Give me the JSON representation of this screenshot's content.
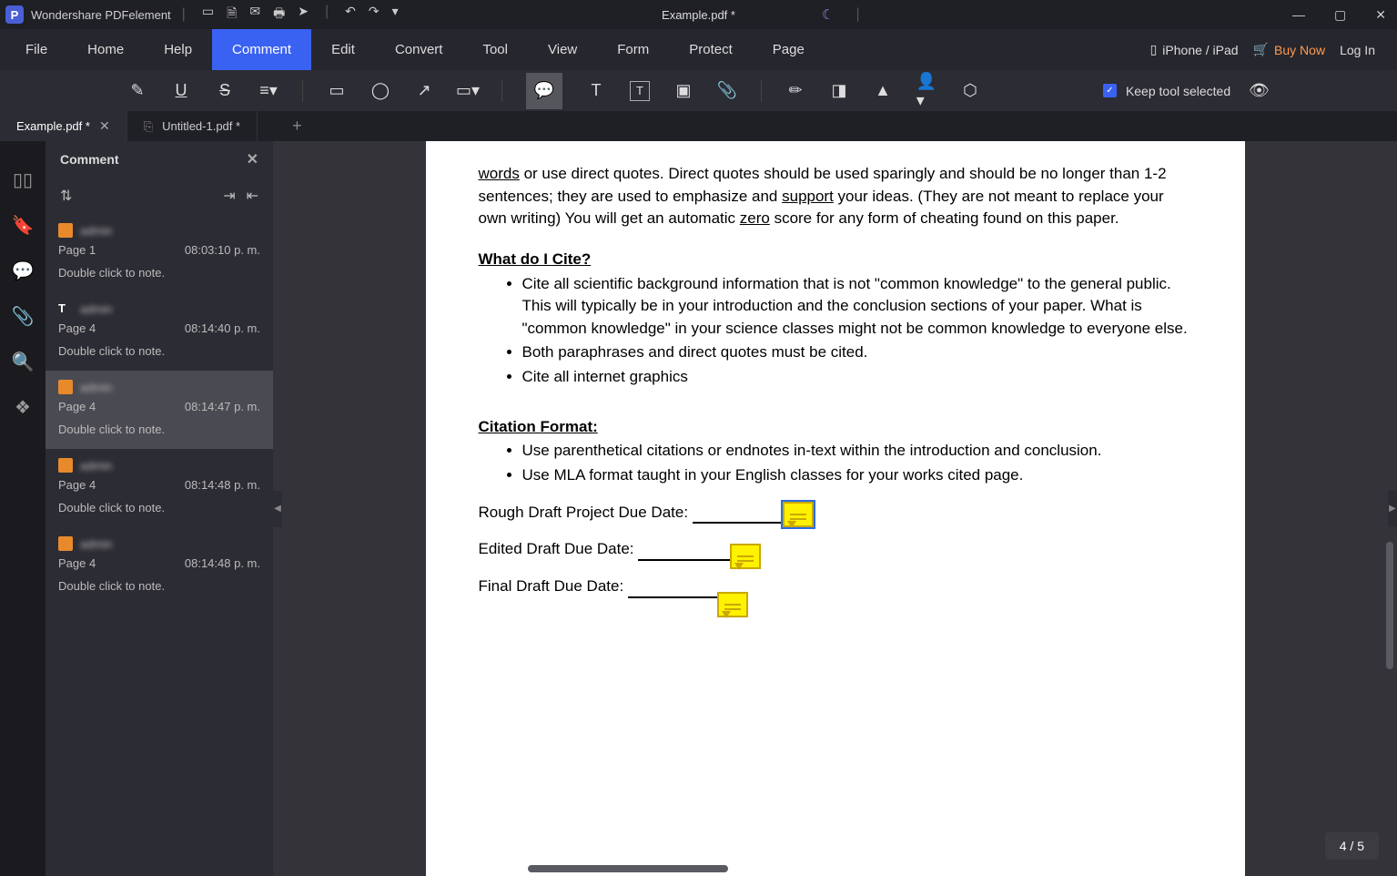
{
  "app": {
    "name": "Wondershare PDFelement",
    "doc_title": "Example.pdf *"
  },
  "titlebar_quick": [
    "folder",
    "save",
    "mail",
    "print",
    "share",
    "",
    "undo",
    "redo",
    "more"
  ],
  "window_controls": {
    "min": "—",
    "max": "▢",
    "close": "✕"
  },
  "menus": [
    "File",
    "Home",
    "Help",
    "Comment",
    "Edit",
    "Convert",
    "Tool",
    "View",
    "Form",
    "Protect",
    "Page"
  ],
  "menu_active_index": 3,
  "header_right": {
    "phone": "iPhone / iPad",
    "buy": "Buy Now",
    "login": "Log In"
  },
  "toolbar": {
    "keep_label": "Keep tool selected"
  },
  "tabs": [
    {
      "label": "Example.pdf *",
      "active": true
    },
    {
      "label": "Untitled-1.pdf *",
      "active": false
    }
  ],
  "panel": {
    "title": "Comment"
  },
  "comments": [
    {
      "page": "Page 1",
      "time": "08:03:10 p. m.",
      "text": "Double click to note.",
      "icon": "note",
      "author": "admin"
    },
    {
      "page": "Page 4",
      "time": "08:14:40 p. m.",
      "text": "Double click to note.",
      "icon": "T",
      "author": "admin"
    },
    {
      "page": "Page 4",
      "time": "08:14:47 p. m.",
      "text": "Double click to note.",
      "icon": "note",
      "author": "admin",
      "selected": true
    },
    {
      "page": "Page 4",
      "time": "08:14:48 p. m.",
      "text": "Double click to note.",
      "icon": "note",
      "author": "admin"
    },
    {
      "page": "Page 4",
      "time": "08:14:48 p. m.",
      "text": "Double click to note.",
      "icon": "note",
      "author": "admin"
    }
  ],
  "page_indicator": "4 / 5",
  "document": {
    "para1_pre": "",
    "para1": " or use direct quotes.   Direct quotes should be used sparingly and should be no longer than 1-2 sentences; they are used to emphasize and ",
    "para1_words": "words",
    "para1_support": "support",
    "para1_b": " your ideas.  (They are not meant to replace your own writing) You will get an automatic ",
    "para1_zero": "zero",
    "para1_c": " score for any form of cheating found on this paper.",
    "h1": "What do I Cite?",
    "b1": "Cite all scientific background information that is not \"common knowledge\" to the general public.  This will typically be in your introduction and the conclusion sections of your paper. What is \"common knowledge\" in your science classes might not be common knowledge to everyone else.",
    "b2": "Both paraphrases and direct quotes must be cited.",
    "b3": "Cite all internet graphics",
    "h2": "Citation Format:",
    "c1": "Use parenthetical citations or endnotes in-text within the introduction and conclusion.",
    "c2": "Use MLA format taught in your English classes for your works cited page.",
    "d1": "Rough Draft Project Due Date:",
    "d2": "Edited Draft Due Date:",
    "d3": "Final Draft Due Date:"
  }
}
